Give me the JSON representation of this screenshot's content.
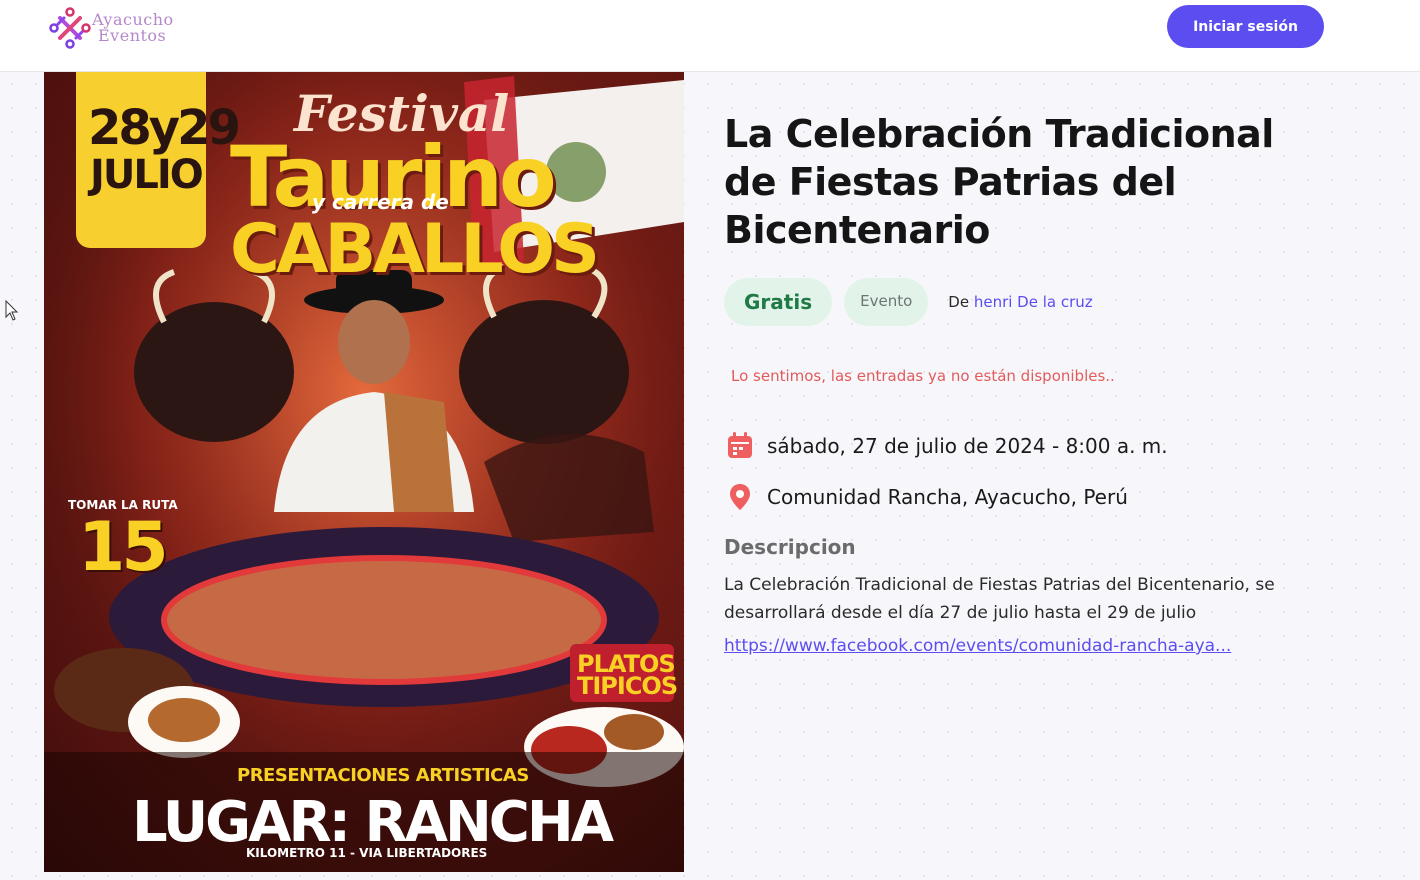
{
  "header": {
    "logo_line1": "Ayacucho",
    "logo_line2": "Eventos",
    "login_label": "Iniciar sesión"
  },
  "poster": {
    "date_days": "28y29",
    "date_month": "JULIO",
    "festival": "Festival",
    "taurino": "Taurino",
    "carrera": "y carrera de",
    "caballos": "CABALLOS",
    "ruta_label": "TOMAR LA RUTA",
    "ruta_number": "15",
    "platos_1": "PLATOS",
    "platos_2": "TIPICOS",
    "presentaciones": "PRESENTACIONES ARTISTICAS",
    "lugar": "LUGAR: RANCHA",
    "kilometro": "KILOMETRO 11 - VIA LIBERTADORES"
  },
  "event": {
    "title": "La Celebración Tradicional de Fiestas Patrias del Bicentenario",
    "price_badge": "Gratis",
    "type_badge": "Evento",
    "author_prefix": "De",
    "author_name": "henri De la cruz",
    "soldout_message": "Lo sentimos, las entradas ya no están disponibles..",
    "datetime": "sábado, 27 de julio de 2024 - 8:00 a. m.",
    "location": "Comunidad Rancha, Ayacucho, Perú",
    "description_heading": "Descripcion",
    "description_text": "La Celebración Tradicional de Fiestas Patrias del Bicentenario, se desarrollará desde el día 27 de julio hasta el 29 de julio",
    "description_link": "https://www.facebook.com/events/comunidad-rancha-aya..."
  },
  "colors": {
    "primary": "#5b4df0",
    "free_badge_bg": "#e2f3ea",
    "free_badge_text": "#1f7a45",
    "soldout_text": "#e25b5b",
    "icon_accent": "#ef5f5f"
  },
  "icons": [
    "logo-mark-icon",
    "calendar-icon",
    "map-pin-icon",
    "cursor-icon"
  ]
}
